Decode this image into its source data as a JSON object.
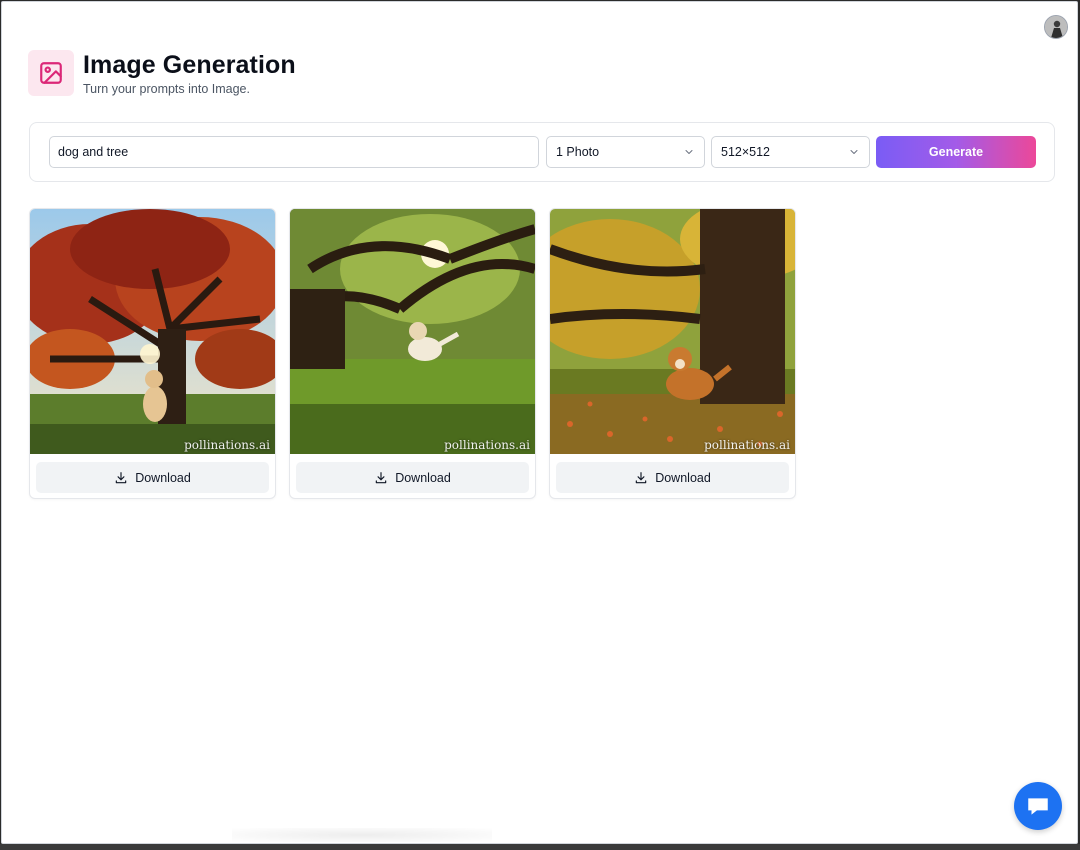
{
  "header": {
    "title": "Image Generation",
    "subtitle": "Turn your prompts into Image.",
    "icon": "image-icon",
    "accent_color": "#db2777"
  },
  "user": {
    "avatar_icon": "user-avatar"
  },
  "controls": {
    "prompt_value": "dog and tree",
    "count_selected": "1 Photo",
    "size_selected": "512×512",
    "generate_label": "Generate",
    "generate_gradient": [
      "#7a5cf5",
      "#ec4899"
    ]
  },
  "gallery": {
    "items": [
      {
        "watermark": "pollinations.ai",
        "download_label": "Download"
      },
      {
        "watermark": "pollinations.ai",
        "download_label": "Download"
      },
      {
        "watermark": "pollinations.ai",
        "download_label": "Download"
      }
    ]
  },
  "chat": {
    "icon": "chat-bubble-icon",
    "color": "#1d72f2"
  }
}
